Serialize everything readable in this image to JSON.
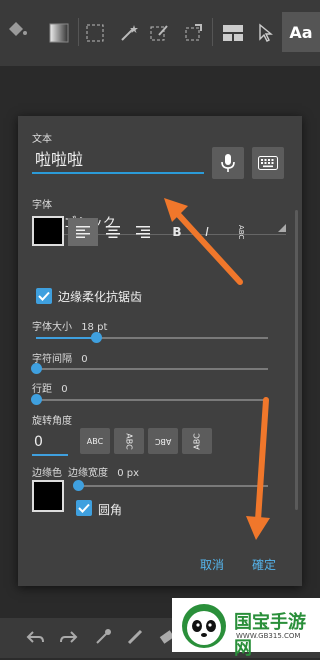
{
  "toolbar": {
    "icons": [
      "paint-bucket-icon",
      "gradient-icon",
      "rect-select-icon",
      "magic-wand-icon",
      "edit-selection-icon",
      "transform-icon",
      "layout-icon",
      "pointer-icon"
    ],
    "text_tool_label": "Aa"
  },
  "dialog": {
    "text_section_label": "文本",
    "text_value": "啦啦啦",
    "font_section_label": "字体",
    "font_value": "IPA Pゴシック",
    "bold_label": "B",
    "italic_label": "I",
    "vertical_label": "ABC",
    "antialias_label": "边缘柔化抗锯齿",
    "font_size_label": "字体大小",
    "font_size_value": "18 pt",
    "letter_spacing_label": "字符间隔",
    "letter_spacing_value": "0",
    "line_spacing_label": "行距",
    "line_spacing_value": "0",
    "rotation_label": "旋转角度",
    "rotation_value": "0",
    "rotation_options": [
      "ABC",
      "ABC",
      "ABC",
      "ABC"
    ],
    "edge_color_label": "边缘色",
    "edge_width_label": "边缘宽度",
    "edge_width_value": "0 px",
    "rounded_label": "圆角",
    "cancel_label": "取消",
    "ok_label": "確定",
    "sliders": {
      "font_size": 0.26,
      "letter_spacing": 0.0,
      "line_spacing": 0.0,
      "edge_width": 0.0
    }
  },
  "watermark": {
    "brand": "国宝手游网",
    "url": "WWW.GB315.COM"
  },
  "colors": {
    "accent": "#3fa0df",
    "arrow": "#f0772b",
    "panel": "#404040"
  }
}
